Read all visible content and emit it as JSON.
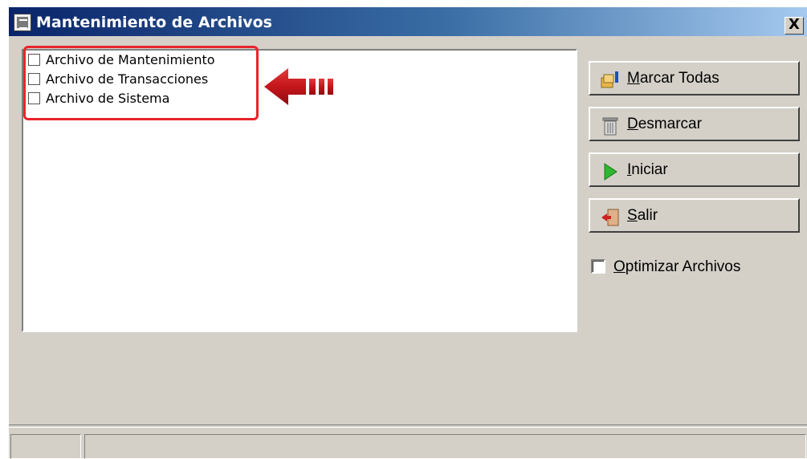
{
  "window": {
    "title": "Mantenimiento de Archivos",
    "close_label": "X"
  },
  "file_list": {
    "items": [
      {
        "label": "Archivo de Mantenimiento",
        "checked": false
      },
      {
        "label": "Archivo de Transacciones",
        "checked": false
      },
      {
        "label": "Archivo de Sistema",
        "checked": false
      }
    ]
  },
  "annotation": {
    "highlight_color": "#e8242b",
    "arrow_color": "#c4161c"
  },
  "buttons": {
    "mark_all": {
      "underlined": "M",
      "rest": "arcar Todas",
      "icon": "mark-all-icon"
    },
    "unmark": {
      "underlined": "D",
      "rest": "esmarcar",
      "icon": "trash-icon"
    },
    "start": {
      "underlined": "I",
      "rest": "niciar",
      "icon": "play-icon"
    },
    "exit": {
      "underlined": "S",
      "rest": "alir",
      "icon": "exit-door-icon"
    }
  },
  "options": {
    "optimize": {
      "underlined": "O",
      "rest": "ptimizar Archivos",
      "checked": false
    }
  },
  "statusbar": {
    "panel1": "",
    "panel2": ""
  }
}
